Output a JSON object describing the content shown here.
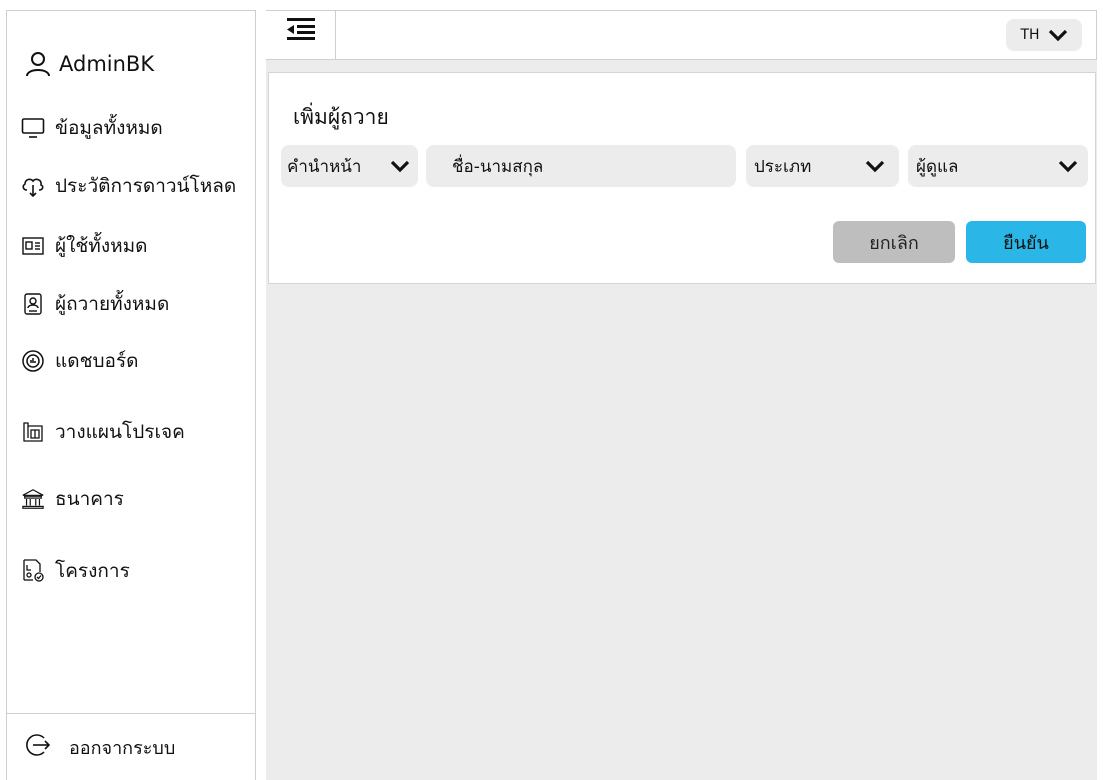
{
  "sidebar": {
    "username": "AdminBK",
    "items": [
      {
        "label": "ข้อมูลทั้งหมด",
        "icon": "monitor-icon"
      },
      {
        "label": "ประวัติการดาวน์โหลด",
        "icon": "cloud-download-icon"
      },
      {
        "label": "ผู้ใช้ทั้งหมด",
        "icon": "id-card-icon"
      },
      {
        "label": "ผู้ถวายทั้งหมด",
        "icon": "person-card-icon"
      },
      {
        "label": "แดชบอร์ด",
        "icon": "dashboard-icon"
      },
      {
        "label": "วางแผนโปรเจค",
        "icon": "blueprint-icon"
      },
      {
        "label": "ธนาคาร",
        "icon": "bank-icon"
      },
      {
        "label": "โครงการ",
        "icon": "project-icon"
      }
    ],
    "logout_label": "ออกจากระบบ"
  },
  "topbar": {
    "lang": "TH"
  },
  "form": {
    "title": "เพิ่มผู้ถวาย",
    "prefix_label": "คำนำหน้า",
    "name_placeholder": "ชื่อ-นามสกุล",
    "type_label": "ประเภท",
    "caretaker_label": "ผู้ดูแล",
    "cancel_label": "ยกเลิก",
    "confirm_label": "ยืนยัน"
  },
  "colors": {
    "confirm": "#2ab6e6",
    "cancel": "#bebebe",
    "content_bg": "#ececec",
    "field_bg": "#ececec"
  }
}
